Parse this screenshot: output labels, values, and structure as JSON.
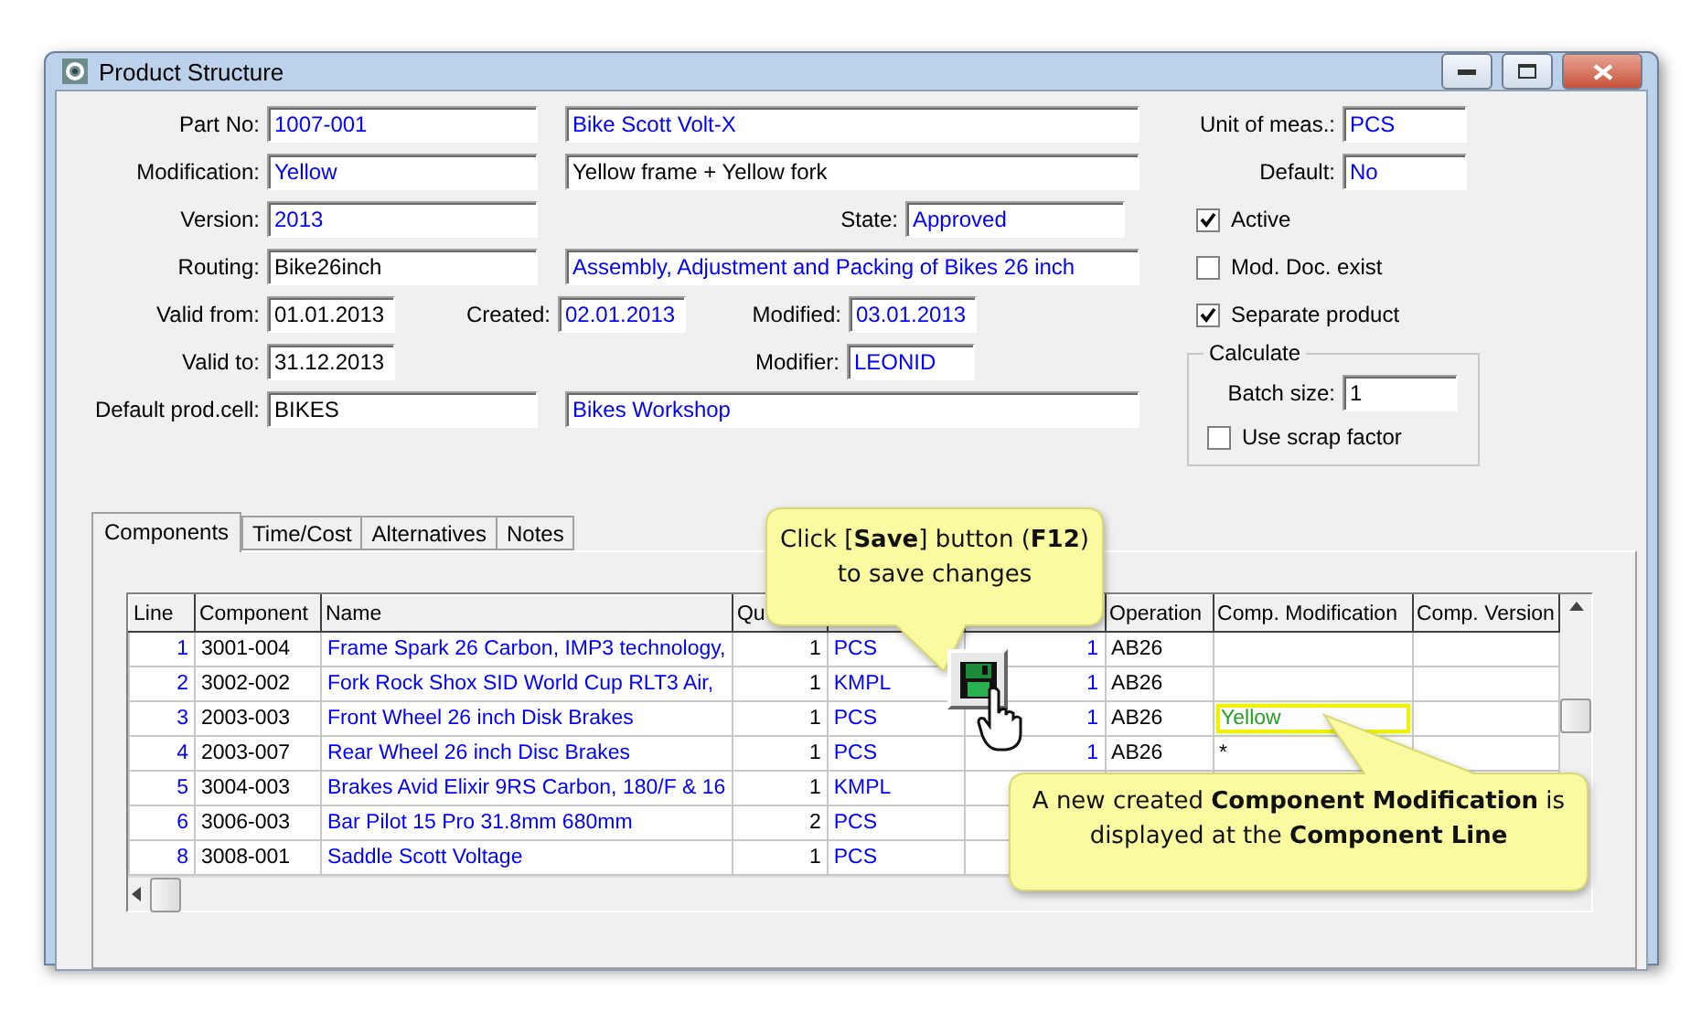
{
  "window": {
    "title": "Product Structure"
  },
  "form": {
    "part_no": {
      "label": "Part No:",
      "value": "1007-001",
      "color": "#0000ff"
    },
    "part_name": {
      "value": "Bike Scott Volt-X",
      "color": "#0000ff"
    },
    "modification": {
      "label": "Modification:",
      "value": "Yellow",
      "color": "#0000ff"
    },
    "modification_description": {
      "value": "Yellow frame + Yellow fork",
      "color": "#000000"
    },
    "version": {
      "label": "Version:",
      "value": "2013",
      "color": "#0000ff"
    },
    "state": {
      "label": "State:",
      "value": "Approved",
      "color": "#0000ff"
    },
    "routing": {
      "label": "Routing:",
      "value": "Bike26inch",
      "color": "#000000"
    },
    "routing_description": {
      "value": "Assembly, Adjustment and Packing of Bikes 26 inch",
      "color": "#0000ff"
    },
    "valid_from": {
      "label": "Valid from:",
      "value": "01.01.2013",
      "color": "#000000"
    },
    "created": {
      "label": "Created:",
      "value": "02.01.2013",
      "color": "#0000ff"
    },
    "modified": {
      "label": "Modified:",
      "value": "03.01.2013",
      "color": "#0000ff"
    },
    "valid_to": {
      "label": "Valid to:",
      "value": "31.12.2013",
      "color": "#000000"
    },
    "modifier": {
      "label": "Modifier:",
      "value": "LEONID",
      "color": "#0000ff"
    },
    "default_prod_cell": {
      "label": "Default prod.cell:",
      "value": "BIKES",
      "color": "#000000"
    },
    "prod_cell_description": {
      "value": "Bikes Workshop",
      "color": "#0000ff"
    },
    "unit_of_meas": {
      "label": "Unit of meas.:",
      "value": "PCS",
      "color": "#0000ff"
    },
    "default": {
      "label": "Default:",
      "value": "No",
      "color": "#0000ff"
    }
  },
  "options": [
    {
      "label": "Active",
      "checked": true
    },
    {
      "label": "Mod. Doc. exist",
      "checked": false
    },
    {
      "label": "Separate product",
      "checked": true
    }
  ],
  "calculate": {
    "title": "Calculate",
    "batch_size": {
      "label": "Batch size:",
      "value": "1"
    },
    "use_scrap_factor": {
      "label": "Use scrap factor",
      "checked": false
    }
  },
  "tabs": [
    {
      "label": "Components",
      "selected": true
    },
    {
      "label": "Time/Cost",
      "selected": false
    },
    {
      "label": "Alternatives",
      "selected": false
    },
    {
      "label": "Notes",
      "selected": false
    }
  ],
  "table": {
    "columns": [
      {
        "label": "Line"
      },
      {
        "label": "Component"
      },
      {
        "label": "Name"
      },
      {
        "label": "Qu"
      },
      {},
      {},
      {
        "label": "Operation"
      },
      {
        "label": "Comp. Modification"
      },
      {
        "label": "Comp. Version"
      }
    ],
    "rows": [
      {
        "line": "1",
        "component": "3001-004",
        "name": "Frame Spark 26 Carbon, IMP3 technology,",
        "qty": "1",
        "unit": "PCS",
        "qty_per_batch": "1",
        "operation": "AB26",
        "selected": false
      },
      {
        "line": "2",
        "component": "3002-002",
        "name": "Fork Rock Shox SID World Cup RLT3 Air,",
        "qty": "1",
        "unit": "KMPL",
        "qty_per_batch": "1",
        "operation": "AB26",
        "selected": false
      },
      {
        "line": "3",
        "component": "2003-003",
        "name": "Front Wheel 26 inch Disk Brakes",
        "qty": "1",
        "unit": "PCS",
        "qty_per_batch": "1",
        "operation": "AB26",
        "comp_modification": "Yellow",
        "selected": true
      },
      {
        "line": "4",
        "component": "2003-007",
        "name": "Rear Wheel 26 inch Disc Brakes",
        "qty": "1",
        "unit": "PCS",
        "qty_per_batch": "1",
        "operation": "AB26",
        "comp_modification": "*",
        "selected": false
      },
      {
        "line": "5",
        "component": "3004-003",
        "name": "Brakes Avid Elixir 9RS Carbon, 180/F & 16",
        "qty": "1",
        "unit": "KMPL",
        "selected": false
      },
      {
        "line": "6",
        "component": "3006-003",
        "name": "Bar Pilot 15 Pro 31.8mm 680mm",
        "qty": "2",
        "unit": "PCS",
        "selected": false
      },
      {
        "line": "8",
        "component": "3008-001",
        "name": "Saddle Scott Voltage",
        "qty": "1",
        "unit": "PCS",
        "selected": false
      }
    ]
  },
  "callouts": [
    {
      "text": "Click [**Save**] button (**F12**) to save changes"
    },
    {
      "text": "A new created **Component Modification** is displayed at the **Component Line**"
    }
  ]
}
